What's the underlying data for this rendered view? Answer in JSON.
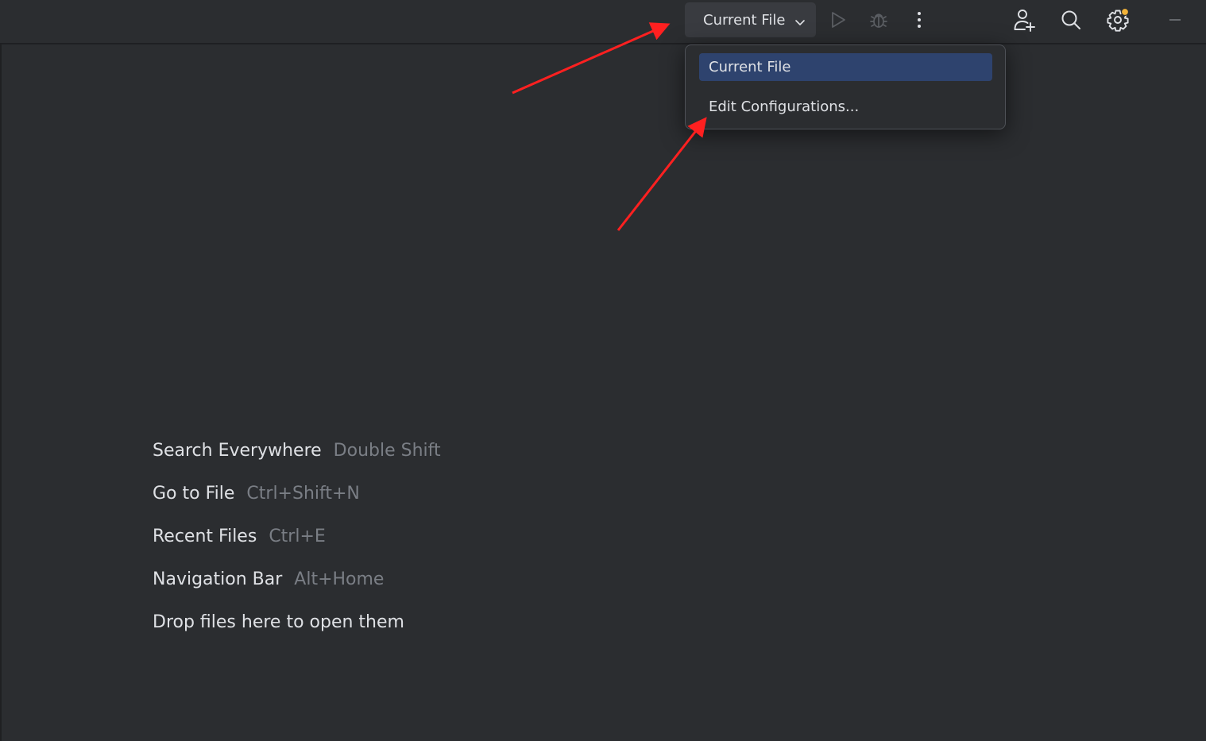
{
  "toolbar": {
    "run_config_label": "Current File",
    "icons": {
      "dropdown": "chevron-down-icon",
      "run": "play-icon",
      "debug": "bug-icon",
      "more": "more-vertical-icon",
      "add_user": "user-plus-icon",
      "search": "search-icon",
      "settings": "gear-icon",
      "minimize": "minimize-icon"
    }
  },
  "popup": {
    "items": [
      {
        "label": "Current File",
        "selected": true
      },
      {
        "label": "Edit Configurations...",
        "selected": false
      }
    ]
  },
  "hints": [
    {
      "action": "Search Everywhere",
      "shortcut": "Double Shift"
    },
    {
      "action": "Go to File",
      "shortcut": "Ctrl+Shift+N"
    },
    {
      "action": "Recent Files",
      "shortcut": "Ctrl+E"
    },
    {
      "action": "Navigation Bar",
      "shortcut": "Alt+Home"
    },
    {
      "action": "Drop files here to open them",
      "shortcut": ""
    }
  ],
  "colors": {
    "background": "#2b2d30",
    "selection": "#2e436e",
    "text": "#dfe1e5",
    "muted_text": "#7a7e85",
    "notification_dot": "#f2b33a",
    "annotation_arrow": "#ff2020"
  }
}
